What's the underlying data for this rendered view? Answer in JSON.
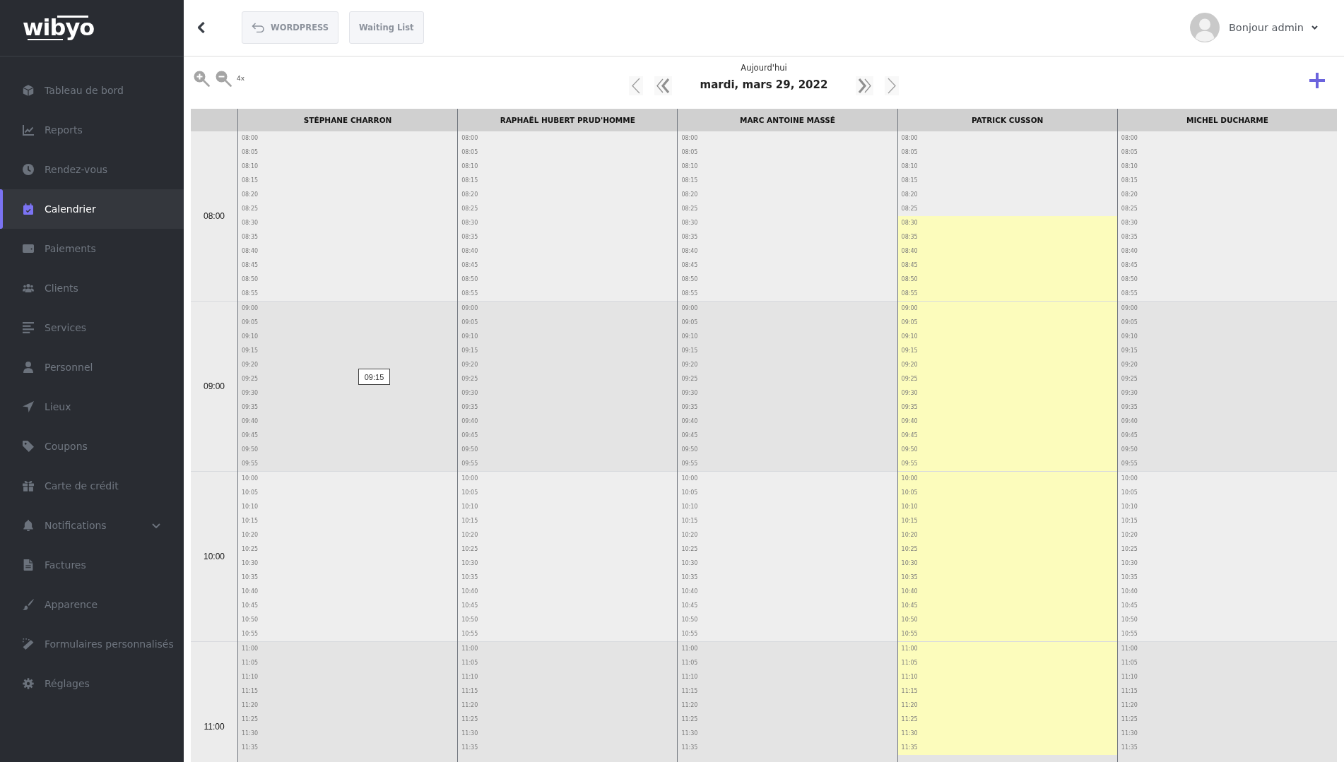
{
  "sidebar": {
    "logo": "wibyo",
    "items": [
      {
        "label": "Tableau de bord",
        "selected": false
      },
      {
        "label": "Reports",
        "selected": false
      },
      {
        "label": "Rendez-vous",
        "selected": false
      },
      {
        "label": "Calendrier",
        "selected": true
      },
      {
        "label": "Paiements",
        "selected": false
      },
      {
        "label": "Clients",
        "selected": false
      },
      {
        "label": "Services",
        "selected": false
      },
      {
        "label": "Personnel",
        "selected": false
      },
      {
        "label": "Lieux",
        "selected": false
      },
      {
        "label": "Coupons",
        "selected": false
      },
      {
        "label": "Carte de crédit",
        "selected": false
      },
      {
        "label": "Notifications",
        "selected": false,
        "expanded": false
      },
      {
        "label": "Factures",
        "selected": false
      },
      {
        "label": "Apparence",
        "selected": false
      },
      {
        "label": "Formulaires personnalisés",
        "selected": false
      },
      {
        "label": "Réglages",
        "selected": false
      }
    ]
  },
  "top_bar": {
    "wordpress_button": "WORDPRESS",
    "waiting_list_button": "Waiting List",
    "user_menu": "Bonjour admin"
  },
  "toolbar": {
    "zoom_level": "4x",
    "today": "Aujourd'hui",
    "date": "mardi, mars 29, 2022"
  },
  "calendar": {
    "hours": [
      "08:00",
      "09:00",
      "10:00",
      "11:00"
    ],
    "columns": [
      {
        "name": "STÉPHANE CHARRON",
        "tooltip": "09:15",
        "hour_blocks": [
          {
            "slots": [
              {
                "time": "08:00",
                "highlighted": false
              },
              {
                "time": "08:05",
                "highlighted": false
              },
              {
                "time": "08:10",
                "highlighted": false
              },
              {
                "time": "08:15",
                "highlighted": false
              },
              {
                "time": "08:20",
                "highlighted": false
              },
              {
                "time": "08:25",
                "highlighted": false
              },
              {
                "time": "08:30",
                "highlighted": false
              },
              {
                "time": "08:35",
                "highlighted": false
              },
              {
                "time": "08:40",
                "highlighted": false
              },
              {
                "time": "08:45",
                "highlighted": false
              },
              {
                "time": "08:50",
                "highlighted": false
              },
              {
                "time": "08:55",
                "highlighted": false
              }
            ]
          },
          {
            "slots": [
              {
                "time": "09:00",
                "highlighted": false
              },
              {
                "time": "09:05",
                "highlighted": false
              },
              {
                "time": "09:10",
                "highlighted": false
              },
              {
                "time": "09:15",
                "highlighted": false
              },
              {
                "time": "09:20",
                "highlighted": false
              },
              {
                "time": "09:25",
                "highlighted": false
              },
              {
                "time": "09:30",
                "highlighted": false
              },
              {
                "time": "09:35",
                "highlighted": false
              },
              {
                "time": "09:40",
                "highlighted": false
              },
              {
                "time": "09:45",
                "highlighted": false
              },
              {
                "time": "09:50",
                "highlighted": false
              },
              {
                "time": "09:55",
                "highlighted": false
              }
            ]
          },
          {
            "slots": [
              {
                "time": "10:00",
                "highlighted": false
              },
              {
                "time": "10:05",
                "highlighted": false
              },
              {
                "time": "10:10",
                "highlighted": false
              },
              {
                "time": "10:15",
                "highlighted": false
              },
              {
                "time": "10:20",
                "highlighted": false
              },
              {
                "time": "10:25",
                "highlighted": false
              },
              {
                "time": "10:30",
                "highlighted": false
              },
              {
                "time": "10:35",
                "highlighted": false
              },
              {
                "time": "10:40",
                "highlighted": false
              },
              {
                "time": "10:45",
                "highlighted": false
              },
              {
                "time": "10:50",
                "highlighted": false
              },
              {
                "time": "10:55",
                "highlighted": false
              }
            ]
          },
          {
            "slots": [
              {
                "time": "11:00",
                "highlighted": false
              },
              {
                "time": "11:05",
                "highlighted": false
              },
              {
                "time": "11:10",
                "highlighted": false
              },
              {
                "time": "11:15",
                "highlighted": false
              },
              {
                "time": "11:20",
                "highlighted": false
              },
              {
                "time": "11:25",
                "highlighted": false
              },
              {
                "time": "11:30",
                "highlighted": false
              },
              {
                "time": "11:35",
                "highlighted": false
              }
            ]
          }
        ]
      },
      {
        "name": "RAPHAËL HUBERT PRUD'HOMME",
        "hour_blocks": [
          {
            "slots": [
              {
                "time": "08:00",
                "highlighted": false
              },
              {
                "time": "08:05",
                "highlighted": false
              },
              {
                "time": "08:10",
                "highlighted": false
              },
              {
                "time": "08:15",
                "highlighted": false
              },
              {
                "time": "08:20",
                "highlighted": false
              },
              {
                "time": "08:25",
                "highlighted": false
              },
              {
                "time": "08:30",
                "highlighted": false
              },
              {
                "time": "08:35",
                "highlighted": false
              },
              {
                "time": "08:40",
                "highlighted": false
              },
              {
                "time": "08:45",
                "highlighted": false
              },
              {
                "time": "08:50",
                "highlighted": false
              },
              {
                "time": "08:55",
                "highlighted": false
              }
            ]
          },
          {
            "slots": [
              {
                "time": "09:00",
                "highlighted": false
              },
              {
                "time": "09:05",
                "highlighted": false
              },
              {
                "time": "09:10",
                "highlighted": false
              },
              {
                "time": "09:15",
                "highlighted": false
              },
              {
                "time": "09:20",
                "highlighted": false
              },
              {
                "time": "09:25",
                "highlighted": false
              },
              {
                "time": "09:30",
                "highlighted": false
              },
              {
                "time": "09:35",
                "highlighted": false
              },
              {
                "time": "09:40",
                "highlighted": false
              },
              {
                "time": "09:45",
                "highlighted": false
              },
              {
                "time": "09:50",
                "highlighted": false
              },
              {
                "time": "09:55",
                "highlighted": false
              }
            ]
          },
          {
            "slots": [
              {
                "time": "10:00",
                "highlighted": false
              },
              {
                "time": "10:05",
                "highlighted": false
              },
              {
                "time": "10:10",
                "highlighted": false
              },
              {
                "time": "10:15",
                "highlighted": false
              },
              {
                "time": "10:20",
                "highlighted": false
              },
              {
                "time": "10:25",
                "highlighted": false
              },
              {
                "time": "10:30",
                "highlighted": false
              },
              {
                "time": "10:35",
                "highlighted": false
              },
              {
                "time": "10:40",
                "highlighted": false
              },
              {
                "time": "10:45",
                "highlighted": false
              },
              {
                "time": "10:50",
                "highlighted": false
              },
              {
                "time": "10:55",
                "highlighted": false
              }
            ]
          },
          {
            "slots": [
              {
                "time": "11:00",
                "highlighted": false
              },
              {
                "time": "11:05",
                "highlighted": false
              },
              {
                "time": "11:10",
                "highlighted": false
              },
              {
                "time": "11:15",
                "highlighted": false
              },
              {
                "time": "11:20",
                "highlighted": false
              },
              {
                "time": "11:25",
                "highlighted": false
              },
              {
                "time": "11:30",
                "highlighted": false
              },
              {
                "time": "11:35",
                "highlighted": false
              }
            ]
          }
        ]
      },
      {
        "name": "MARC ANTOINE MASSÉ",
        "hour_blocks": [
          {
            "slots": [
              {
                "time": "08:00",
                "highlighted": false
              },
              {
                "time": "08:05",
                "highlighted": false
              },
              {
                "time": "08:10",
                "highlighted": false
              },
              {
                "time": "08:15",
                "highlighted": false
              },
              {
                "time": "08:20",
                "highlighted": false
              },
              {
                "time": "08:25",
                "highlighted": false
              },
              {
                "time": "08:30",
                "highlighted": false
              },
              {
                "time": "08:35",
                "highlighted": false
              },
              {
                "time": "08:40",
                "highlighted": false
              },
              {
                "time": "08:45",
                "highlighted": false
              },
              {
                "time": "08:50",
                "highlighted": false
              },
              {
                "time": "08:55",
                "highlighted": false
              }
            ]
          },
          {
            "slots": [
              {
                "time": "09:00",
                "highlighted": false
              },
              {
                "time": "09:05",
                "highlighted": false
              },
              {
                "time": "09:10",
                "highlighted": false
              },
              {
                "time": "09:15",
                "highlighted": false
              },
              {
                "time": "09:20",
                "highlighted": false
              },
              {
                "time": "09:25",
                "highlighted": false
              },
              {
                "time": "09:30",
                "highlighted": false
              },
              {
                "time": "09:35",
                "highlighted": false
              },
              {
                "time": "09:40",
                "highlighted": false
              },
              {
                "time": "09:45",
                "highlighted": false
              },
              {
                "time": "09:50",
                "highlighted": false
              },
              {
                "time": "09:55",
                "highlighted": false
              }
            ]
          },
          {
            "slots": [
              {
                "time": "10:00",
                "highlighted": false
              },
              {
                "time": "10:05",
                "highlighted": false
              },
              {
                "time": "10:10",
                "highlighted": false
              },
              {
                "time": "10:15",
                "highlighted": false
              },
              {
                "time": "10:20",
                "highlighted": false
              },
              {
                "time": "10:25",
                "highlighted": false
              },
              {
                "time": "10:30",
                "highlighted": false
              },
              {
                "time": "10:35",
                "highlighted": false
              },
              {
                "time": "10:40",
                "highlighted": false
              },
              {
                "time": "10:45",
                "highlighted": false
              },
              {
                "time": "10:50",
                "highlighted": false
              },
              {
                "time": "10:55",
                "highlighted": false
              }
            ]
          },
          {
            "slots": [
              {
                "time": "11:00",
                "highlighted": false
              },
              {
                "time": "11:05",
                "highlighted": false
              },
              {
                "time": "11:10",
                "highlighted": false
              },
              {
                "time": "11:15",
                "highlighted": false
              },
              {
                "time": "11:20",
                "highlighted": false
              },
              {
                "time": "11:25",
                "highlighted": false
              },
              {
                "time": "11:30",
                "highlighted": false
              },
              {
                "time": "11:35",
                "highlighted": false
              }
            ]
          }
        ]
      },
      {
        "name": "PATRICK CUSSON",
        "hour_blocks": [
          {
            "slots": [
              {
                "time": "08:00",
                "highlighted": false
              },
              {
                "time": "08:05",
                "highlighted": false
              },
              {
                "time": "08:10",
                "highlighted": false
              },
              {
                "time": "08:15",
                "highlighted": false
              },
              {
                "time": "08:20",
                "highlighted": false
              },
              {
                "time": "08:25",
                "highlighted": false
              },
              {
                "time": "08:30",
                "highlighted": true
              },
              {
                "time": "08:35",
                "highlighted": true
              },
              {
                "time": "08:40",
                "highlighted": true
              },
              {
                "time": "08:45",
                "highlighted": true
              },
              {
                "time": "08:50",
                "highlighted": true
              },
              {
                "time": "08:55",
                "highlighted": true
              }
            ]
          },
          {
            "slots": [
              {
                "time": "09:00",
                "highlighted": true
              },
              {
                "time": "09:05",
                "highlighted": true
              },
              {
                "time": "09:10",
                "highlighted": true
              },
              {
                "time": "09:15",
                "highlighted": true
              },
              {
                "time": "09:20",
                "highlighted": true
              },
              {
                "time": "09:25",
                "highlighted": true
              },
              {
                "time": "09:30",
                "highlighted": true
              },
              {
                "time": "09:35",
                "highlighted": true
              },
              {
                "time": "09:40",
                "highlighted": true
              },
              {
                "time": "09:45",
                "highlighted": true
              },
              {
                "time": "09:50",
                "highlighted": true
              },
              {
                "time": "09:55",
                "highlighted": true
              }
            ]
          },
          {
            "slots": [
              {
                "time": "10:00",
                "highlighted": true
              },
              {
                "time": "10:05",
                "highlighted": true
              },
              {
                "time": "10:10",
                "highlighted": true
              },
              {
                "time": "10:15",
                "highlighted": true
              },
              {
                "time": "10:20",
                "highlighted": true
              },
              {
                "time": "10:25",
                "highlighted": true
              },
              {
                "time": "10:30",
                "highlighted": true
              },
              {
                "time": "10:35",
                "highlighted": true
              },
              {
                "time": "10:40",
                "highlighted": true
              },
              {
                "time": "10:45",
                "highlighted": true
              },
              {
                "time": "10:50",
                "highlighted": true
              },
              {
                "time": "10:55",
                "highlighted": true
              }
            ]
          },
          {
            "slots": [
              {
                "time": "11:00",
                "highlighted": true
              },
              {
                "time": "11:05",
                "highlighted": true
              },
              {
                "time": "11:10",
                "highlighted": true
              },
              {
                "time": "11:15",
                "highlighted": true
              },
              {
                "time": "11:20",
                "highlighted": true
              },
              {
                "time": "11:25",
                "highlighted": true
              },
              {
                "time": "11:30",
                "highlighted": true
              },
              {
                "time": "11:35",
                "highlighted": true
              }
            ]
          }
        ]
      },
      {
        "name": "MICHEL DUCHARME",
        "hour_blocks": [
          {
            "slots": [
              {
                "time": "08:00",
                "highlighted": false
              },
              {
                "time": "08:05",
                "highlighted": false
              },
              {
                "time": "08:10",
                "highlighted": false
              },
              {
                "time": "08:15",
                "highlighted": false
              },
              {
                "time": "08:20",
                "highlighted": false
              },
              {
                "time": "08:25",
                "highlighted": false
              },
              {
                "time": "08:30",
                "highlighted": false
              },
              {
                "time": "08:35",
                "highlighted": false
              },
              {
                "time": "08:40",
                "highlighted": false
              },
              {
                "time": "08:45",
                "highlighted": false
              },
              {
                "time": "08:50",
                "highlighted": false
              },
              {
                "time": "08:55",
                "highlighted": false
              }
            ]
          },
          {
            "slots": [
              {
                "time": "09:00",
                "highlighted": false
              },
              {
                "time": "09:05",
                "highlighted": false
              },
              {
                "time": "09:10",
                "highlighted": false
              },
              {
                "time": "09:15",
                "highlighted": false
              },
              {
                "time": "09:20",
                "highlighted": false
              },
              {
                "time": "09:25",
                "highlighted": false
              },
              {
                "time": "09:30",
                "highlighted": false
              },
              {
                "time": "09:35",
                "highlighted": false
              },
              {
                "time": "09:40",
                "highlighted": false
              },
              {
                "time": "09:45",
                "highlighted": false
              },
              {
                "time": "09:50",
                "highlighted": false
              },
              {
                "time": "09:55",
                "highlighted": false
              }
            ]
          },
          {
            "slots": [
              {
                "time": "10:00",
                "highlighted": false
              },
              {
                "time": "10:05",
                "highlighted": false
              },
              {
                "time": "10:10",
                "highlighted": false
              },
              {
                "time": "10:15",
                "highlighted": false
              },
              {
                "time": "10:20",
                "highlighted": false
              },
              {
                "time": "10:25",
                "highlighted": false
              },
              {
                "time": "10:30",
                "highlighted": false
              },
              {
                "time": "10:35",
                "highlighted": false
              },
              {
                "time": "10:40",
                "highlighted": false
              },
              {
                "time": "10:45",
                "highlighted": false
              },
              {
                "time": "10:50",
                "highlighted": false
              },
              {
                "time": "10:55",
                "highlighted": false
              }
            ]
          },
          {
            "slots": [
              {
                "time": "11:00",
                "highlighted": false
              },
              {
                "time": "11:05",
                "highlighted": false
              },
              {
                "time": "11:10",
                "highlighted": false
              },
              {
                "time": "11:15",
                "highlighted": false
              },
              {
                "time": "11:20",
                "highlighted": false
              },
              {
                "time": "11:25",
                "highlighted": false
              },
              {
                "time": "11:30",
                "highlighted": false
              },
              {
                "time": "11:35",
                "highlighted": false
              }
            ]
          }
        ]
      }
    ]
  }
}
